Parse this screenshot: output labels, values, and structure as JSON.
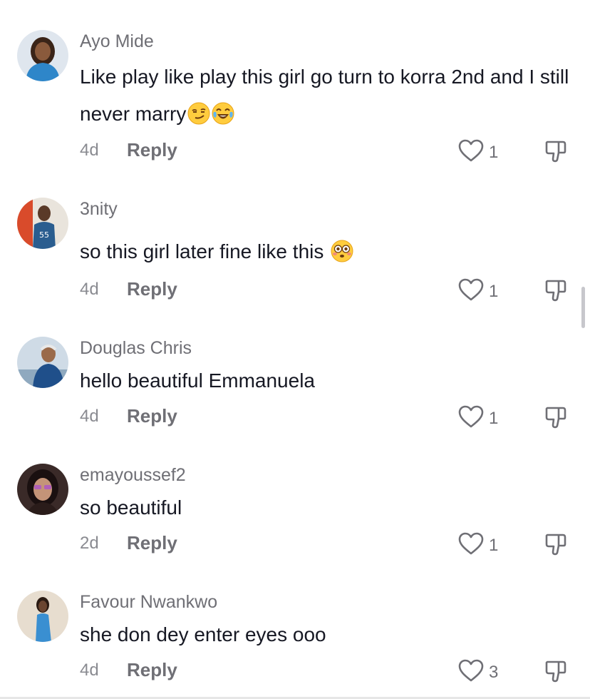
{
  "comments": [
    {
      "username": "Ayo Mide",
      "text": "Like play like play this girl go turn to korra 2nd and I still never marry",
      "emojis": [
        "smirk-emoji",
        "tears-of-joy-emoji"
      ],
      "age": "4d",
      "reply_label": "Reply",
      "likes": "1",
      "avatar_colors": {
        "bg": "#dfe6ee",
        "skin": "#8a5a3c",
        "hair": "#3a2418",
        "outfit": "#2e86c9"
      }
    },
    {
      "username": "3nity",
      "text": "so this girl later fine like this",
      "emojis": [
        "flushed-emoji"
      ],
      "age": "4d",
      "reply_label": "Reply",
      "likes": "1",
      "avatar_colors": {
        "bg": "#e9e4dc",
        "skin": "#5a3a28",
        "hair": "#1f1410",
        "outfit": "#2a5d8f"
      }
    },
    {
      "username": "Douglas Chris",
      "text": "hello beautiful Emmanuela",
      "emojis": [],
      "age": "4d",
      "reply_label": "Reply",
      "likes": "1",
      "avatar_colors": {
        "bg": "#cfdbe6",
        "skin": "#9a6a4a",
        "hair": "#e8e8e8",
        "outfit": "#1f4f8a"
      }
    },
    {
      "username": "emayoussef2",
      "text": "so beautiful",
      "emojis": [],
      "age": "2d",
      "reply_label": "Reply",
      "likes": "1",
      "avatar_colors": {
        "bg": "#3a2a28",
        "skin": "#c49478",
        "hair": "#1a1010",
        "outfit": "#b05fb8"
      }
    },
    {
      "username": "Favour Nwankwo",
      "text": "she don dey enter eyes ooo",
      "emojis": [],
      "age": "4d",
      "reply_label": "Reply",
      "likes": "3",
      "avatar_colors": {
        "bg": "#e7ddcf",
        "skin": "#6b4530",
        "hair": "#2a1a12",
        "outfit": "#3a8fd1"
      }
    }
  ],
  "colors": {
    "text": "#161823",
    "username": "#6f6f75",
    "meta": "#8a8b91",
    "icon": "#6f6f75",
    "emoji_face": "#ffcc3e"
  }
}
